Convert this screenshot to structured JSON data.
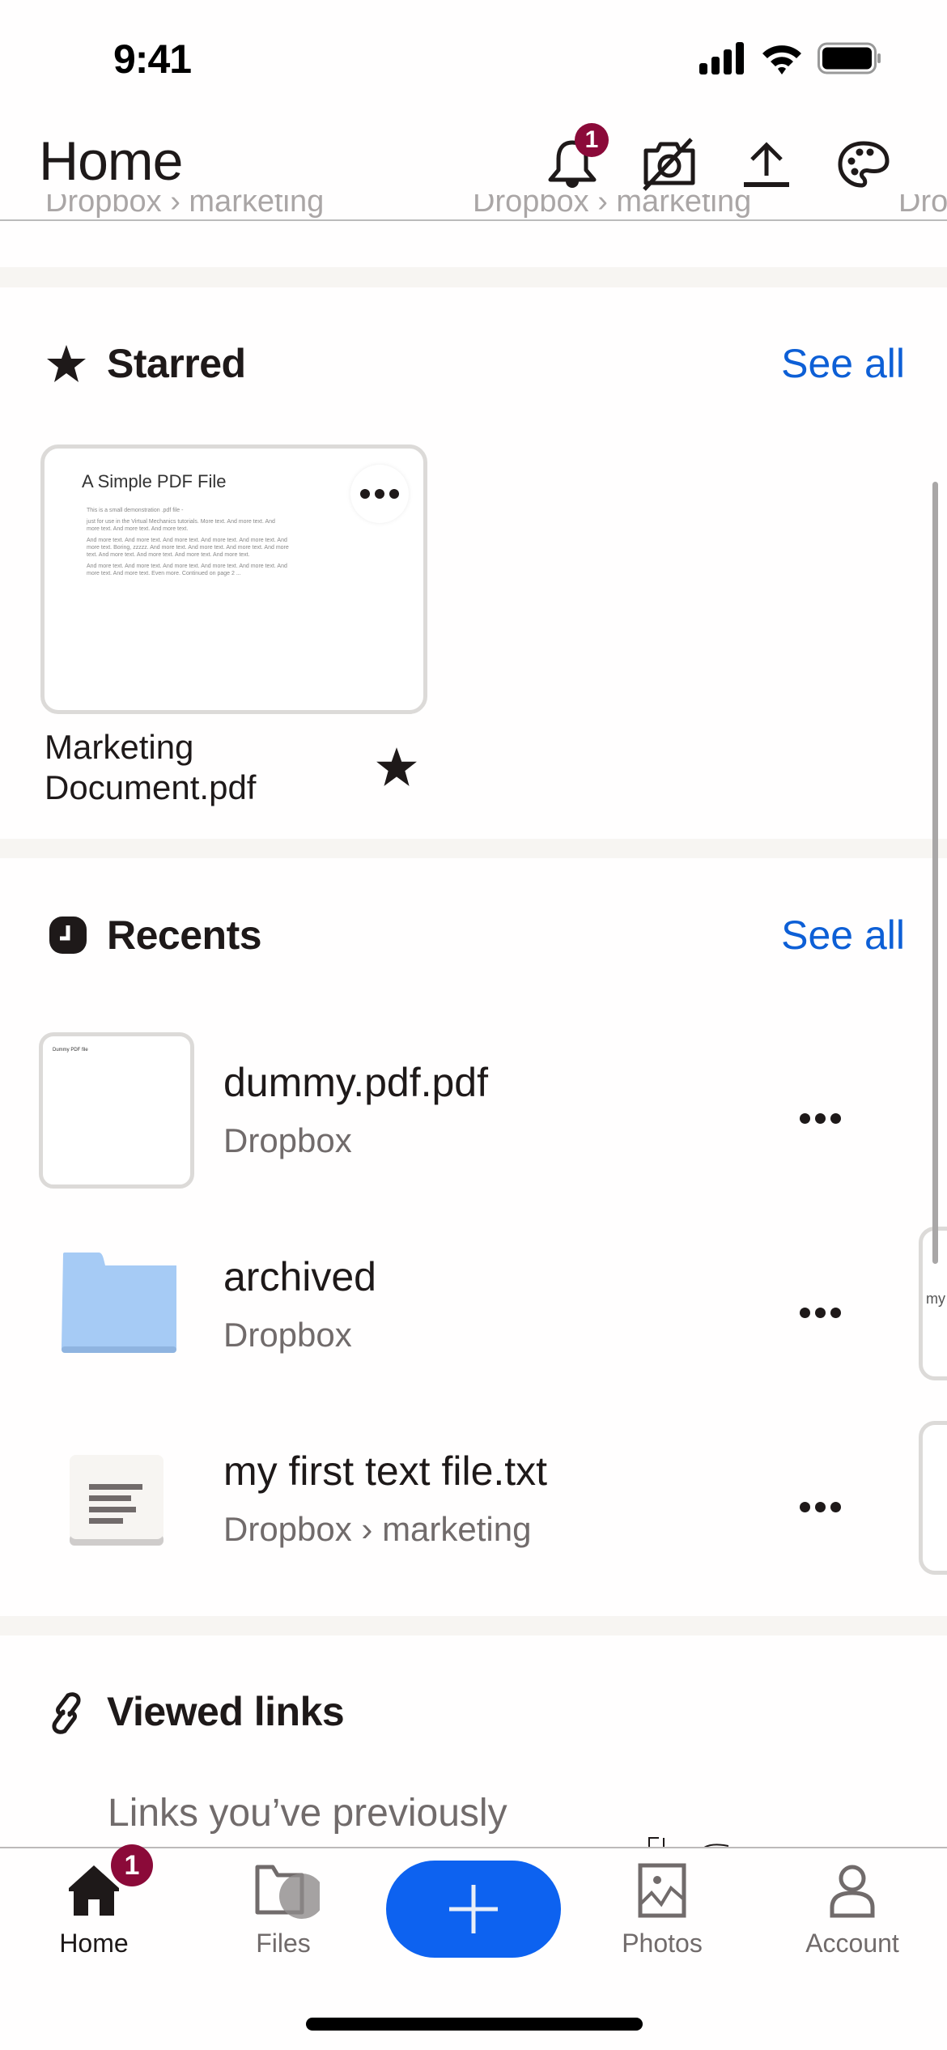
{
  "status_bar": {
    "time": "9:41"
  },
  "header": {
    "title": "Home",
    "notification_count": "1",
    "icons": [
      "bell-icon",
      "camera-off-icon",
      "upload-icon",
      "palette-icon"
    ]
  },
  "behind_header": [
    "Dropbox › marketing",
    "Dropbox › marketing",
    "Dro"
  ],
  "starred": {
    "title": "Starred",
    "see_all": "See all",
    "items": [
      {
        "name_line1": "Marketing",
        "name_line2": "Document.pdf",
        "preview": {
          "title": "A Simple PDF File",
          "lines": [
            "This is a small demonstration .pdf file -",
            "just for use in the Virtual Mechanics tutorials. More text. And more text. And more text. And more text. And more text.",
            "And more text. And more text. And more text. And more text. And more text. And more text. Boring, zzzzz. And more text. And more text. And more text. And more text. And more text. And more text. And more text. And more text.",
            "And more text. And more text. And more text. And more text. And more text. And more text. And more text. Even more. Continued on page 2 ..."
          ]
        }
      }
    ]
  },
  "recents": {
    "title": "Recents",
    "see_all": "See all",
    "items": [
      {
        "name": "dummy.pdf.pdf",
        "location": "Dropbox",
        "type": "pdf",
        "thumb_text": "Dummy PDF file"
      },
      {
        "name": "archived",
        "location": "Dropbox",
        "type": "folder"
      },
      {
        "name": "my first text file.txt",
        "location": "Dropbox › marketing",
        "type": "text"
      }
    ],
    "peek_text": "my"
  },
  "viewed_links": {
    "title": "Viewed links",
    "subtitle": "Links you’ve previously"
  },
  "tabbar": {
    "home_badge": "1",
    "tabs": [
      {
        "label": "Home",
        "icon": "home-icon",
        "active": true
      },
      {
        "label": "Files",
        "icon": "folder-icon",
        "active": false
      },
      {
        "label": "Photos",
        "icon": "photo-icon",
        "active": false
      },
      {
        "label": "Account",
        "icon": "person-icon",
        "active": false
      }
    ],
    "fab_icon": "plus-icon"
  },
  "colors": {
    "accent_blue": "#0d62f0",
    "link_blue": "#0d5fd6",
    "badge": "#8b0a39",
    "folder": "#a6cbf5"
  }
}
